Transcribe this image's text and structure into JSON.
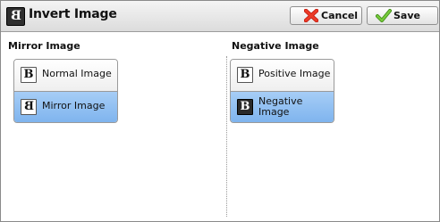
{
  "window": {
    "title": "Invert Image",
    "title_icon_glyph": "B",
    "cancel_label": "Cancel",
    "save_label": "Save"
  },
  "mirror": {
    "title": "Mirror Image",
    "options": [
      {
        "label": "Normal Image",
        "glyph": "B",
        "selected": false
      },
      {
        "label": "Mirror Image",
        "glyph": "B",
        "selected": true
      }
    ]
  },
  "negative": {
    "title": "Negative Image",
    "options": [
      {
        "label": "Positive Image",
        "glyph": "B",
        "selected": false
      },
      {
        "label": "Negative Image",
        "glyph": "B",
        "selected": true
      }
    ]
  },
  "colors": {
    "selected": "#8dbdf1",
    "cancel_icon": "#e0261b",
    "save_icon": "#5fb82a"
  },
  "icons": {
    "title": "mirror-b-icon",
    "cancel": "cancel-x-icon",
    "save": "save-checkmark-icon"
  }
}
